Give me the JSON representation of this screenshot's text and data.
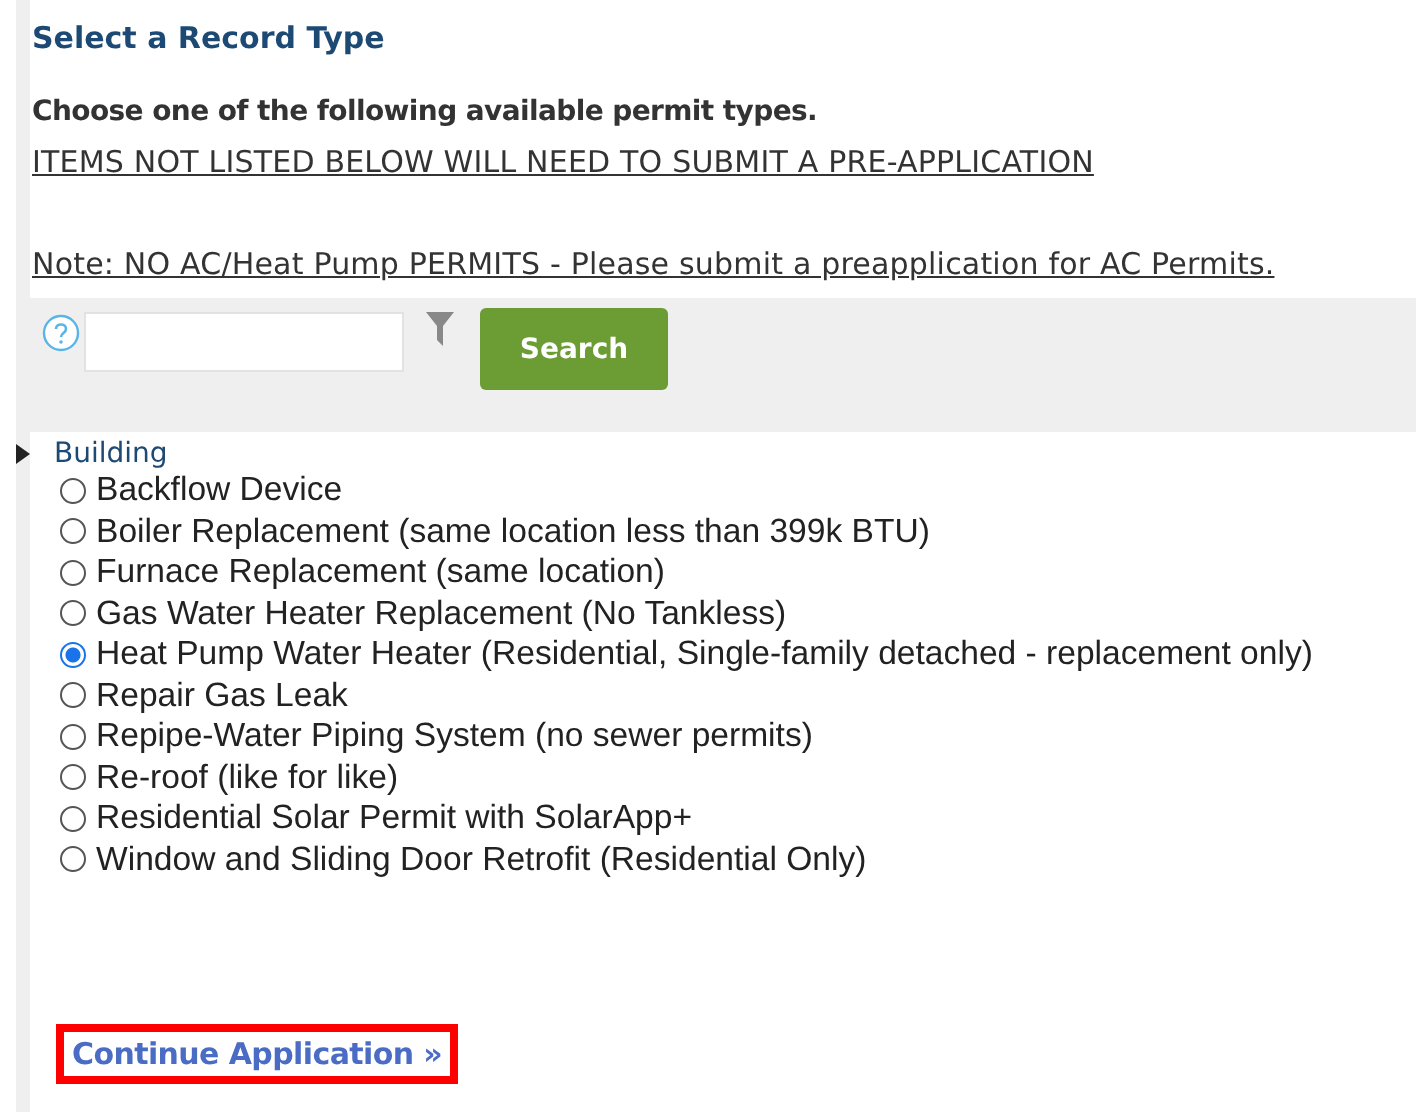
{
  "heading": "Select a Record Type",
  "intro": "Choose one of the following available permit types.",
  "notices": [
    "ITEMS NOT LISTED BELOW WILL NEED TO SUBMIT A PRE-APPLICATION",
    "Note: NO AC/Heat Pump PERMITS - Please submit a preapplication for AC Permits."
  ],
  "search": {
    "button": "Search"
  },
  "tree": {
    "label": "Building",
    "expanded": true,
    "items": [
      {
        "label": "Backflow Device",
        "selected": false
      },
      {
        "label": "Boiler Replacement (same location less than 399k BTU)",
        "selected": false
      },
      {
        "label": "Furnace Replacement (same location)",
        "selected": false
      },
      {
        "label": "Gas Water Heater Replacement (No Tankless)",
        "selected": false
      },
      {
        "label": "Heat Pump Water Heater (Residential, Single-family detached - replacement only)",
        "selected": true
      },
      {
        "label": "Repair Gas Leak",
        "selected": false
      },
      {
        "label": "Repipe-Water Piping System (no sewer permits)",
        "selected": false
      },
      {
        "label": "Re-roof (like for like)",
        "selected": false
      },
      {
        "label": "Residential Solar Permit with SolarApp+",
        "selected": false
      },
      {
        "label": "Window and Sliding Door Retrofit (Residential Only)",
        "selected": false
      }
    ]
  },
  "continue_link": {
    "label": "Continue Application »",
    "highlighted": true
  }
}
